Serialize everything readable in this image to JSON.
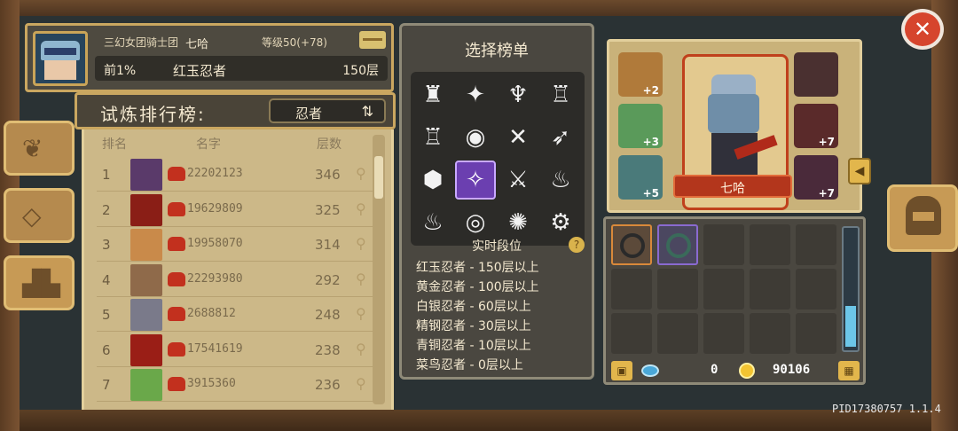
{
  "player": {
    "guild": "三幻女团骑士团",
    "name": "七哈",
    "level": "等级50(+78)",
    "rank_pct": "前1%",
    "title": "红玉忍者",
    "floors": "150层"
  },
  "leaderboard": {
    "title": "试炼排行榜:",
    "category": "忍者",
    "swap_icon": "swap-arrows-icon",
    "columns": {
      "rank": "排名",
      "name": "名字",
      "floors": "层数"
    },
    "rows": [
      {
        "rank": "1",
        "name": "22202123",
        "floors": "346",
        "avatar_color": "#5a3a6a"
      },
      {
        "rank": "2",
        "name": "19629809",
        "floors": "325",
        "avatar_color": "#8a1e16"
      },
      {
        "rank": "3",
        "name": "19958070",
        "floors": "314",
        "avatar_color": "#c98a4a"
      },
      {
        "rank": "4",
        "name": "22293980",
        "floors": "292",
        "avatar_color": "#8f6a4a"
      },
      {
        "rank": "5",
        "name": "2688812",
        "floors": "248",
        "avatar_color": "#7a7a8a"
      },
      {
        "rank": "6",
        "name": "17541619",
        "floors": "238",
        "avatar_color": "#9a1e16"
      },
      {
        "rank": "7",
        "name": "3915360",
        "floors": "236",
        "avatar_color": "#6aa84a"
      }
    ]
  },
  "select_panel": {
    "title": "选择榜单",
    "icons": [
      "knight-icon",
      "star-burst-icon",
      "berserker-icon",
      "engineer-icon",
      "temple-icon",
      "vortex-icon",
      "crossed-blades-icon",
      "arrows-icon",
      "hexagon-icon",
      "ninja-star-icon",
      "claw-icon",
      "flame-icon",
      "shield-wings-icon",
      "swirl-icon",
      "angel-icon",
      "gear-icon"
    ],
    "icon_glyphs": [
      "♜",
      "✦",
      "♆",
      "♖",
      "♖",
      "◉",
      "✕",
      "➶",
      "⬢",
      "✧",
      "⚔",
      "♨",
      "♨",
      "◎",
      "✺",
      "⚙"
    ],
    "selected_index": 9,
    "tier_title": "实时段位",
    "help": "?",
    "tiers": [
      "红玉忍者 - 150层以上",
      "黄金忍者 - 100层以上",
      "白银忍者 - 60层以上",
      "精钢忍者 - 30层以上",
      "青铜忍者 - 10层以上",
      "菜鸟忍者 - 0层以上"
    ]
  },
  "character": {
    "name": "七哈",
    "equipment": [
      {
        "slot": "helmet-item-icon",
        "level": "+2",
        "bg": "#b07a3a"
      },
      {
        "slot": "belt-item-icon",
        "level": "+3",
        "bg": "#5a9a5a"
      },
      {
        "slot": "bracer-item-icon",
        "level": "+5",
        "bg": "#4a7a7a"
      },
      {
        "slot": "dark-helmet-item-icon",
        "level": "",
        "bg": "#4a3030"
      },
      {
        "slot": "gauntlet-item-icon",
        "level": "+7",
        "bg": "#5a2a2a"
      },
      {
        "slot": "blade-item-icon",
        "level": "+7",
        "bg": "#4a2a3a"
      }
    ]
  },
  "inventory": {
    "gems": "0",
    "coins": "90106"
  },
  "colors": {
    "accent_gold": "#caa760",
    "ribbon_red": "#b3361c",
    "selected_purple": "#6b3fb0"
  },
  "footer": {
    "pid": "PID17380757 1.1.4"
  }
}
